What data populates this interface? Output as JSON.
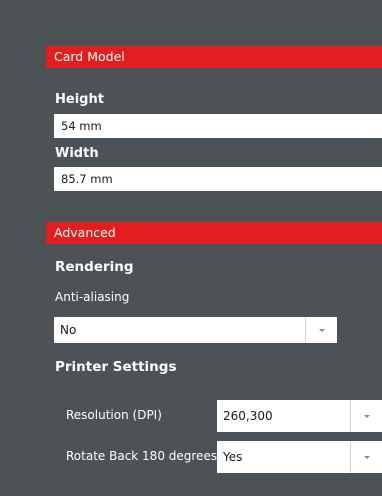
{
  "card_model": {
    "header": "Card Model",
    "height_label": "Height",
    "height_value": "54 mm",
    "width_label": "Width",
    "width_value": "85.7 mm"
  },
  "advanced": {
    "header": "Advanced",
    "rendering_title": "Rendering",
    "anti_aliasing_label": "Anti-aliasing",
    "anti_aliasing_value": "No",
    "printer_settings_title": "Printer Settings",
    "resolution_label": "Resolution (DPI)",
    "resolution_value": "260,300",
    "rotate_label": "Rotate Back 180 degrees",
    "rotate_value": "Yes"
  },
  "icons": {
    "dropdown": "chevron-down-icon"
  },
  "colors": {
    "background": "#4d5257",
    "accent": "#e21e1e",
    "input_background": "#ffffff",
    "text": "#ffffff"
  }
}
